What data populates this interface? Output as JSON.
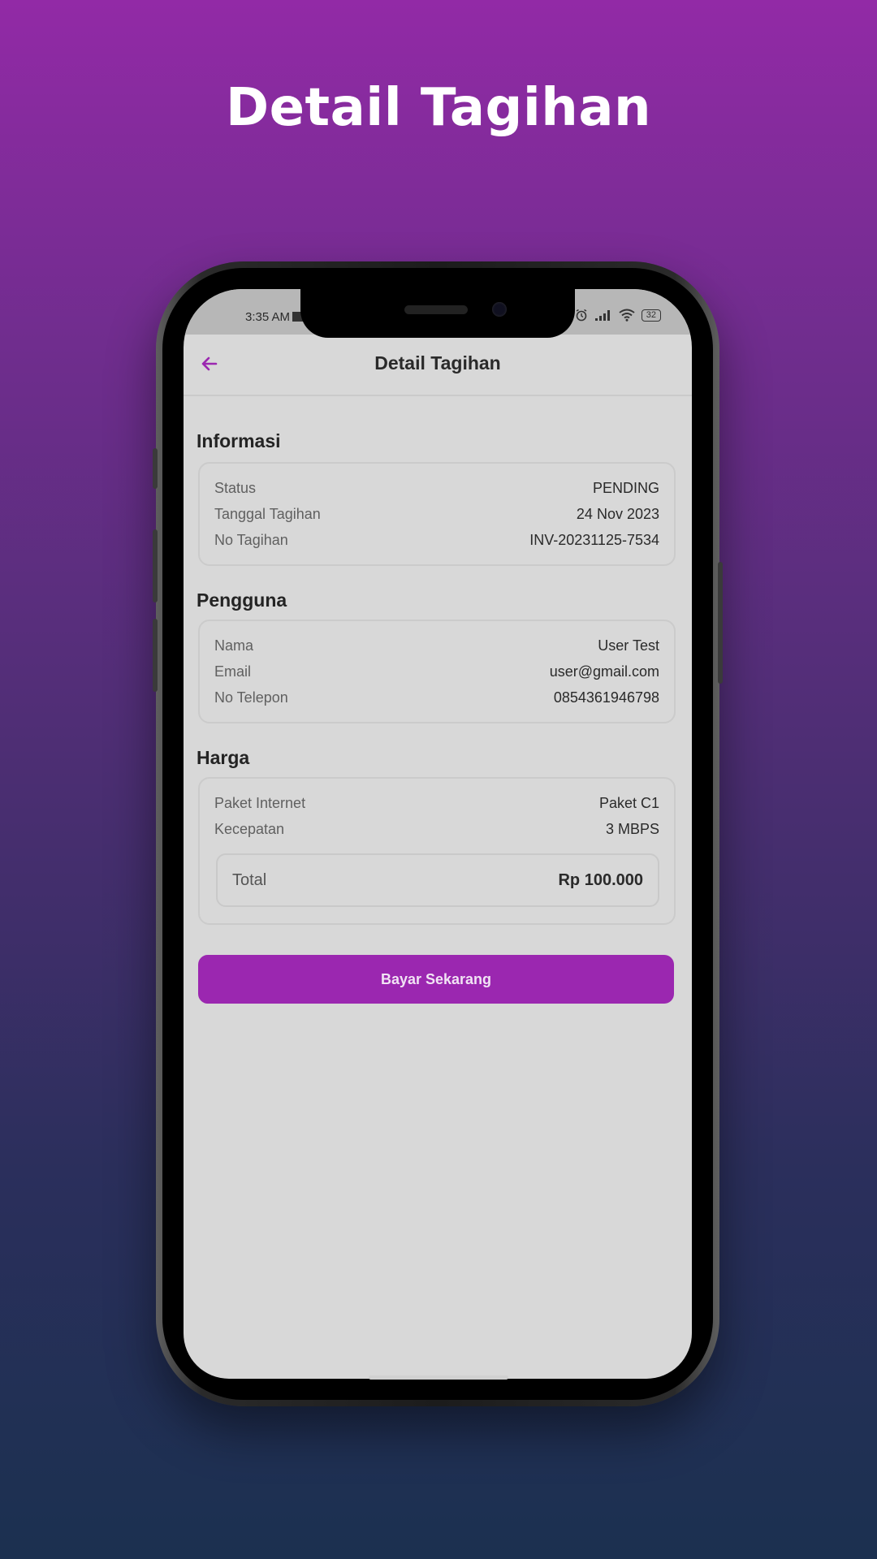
{
  "promo": {
    "title": "Detail Tagihan"
  },
  "status_bar": {
    "time": "3:35 AM",
    "battery": "32"
  },
  "app_bar": {
    "title": "Detail Tagihan"
  },
  "sections": {
    "informasi": {
      "title": "Informasi",
      "rows": [
        {
          "label": "Status",
          "value": "PENDING"
        },
        {
          "label": "Tanggal Tagihan",
          "value": "24 Nov 2023"
        },
        {
          "label": "No Tagihan",
          "value": "INV-20231125-7534"
        }
      ]
    },
    "pengguna": {
      "title": "Pengguna",
      "rows": [
        {
          "label": "Nama",
          "value": "User Test"
        },
        {
          "label": "Email",
          "value": "user@gmail.com"
        },
        {
          "label": "No Telepon",
          "value": "0854361946798"
        }
      ]
    },
    "harga": {
      "title": "Harga",
      "rows": [
        {
          "label": "Paket Internet",
          "value": "Paket C1"
        },
        {
          "label": "Kecepatan",
          "value": "3 MBPS"
        }
      ],
      "total_label": "Total",
      "total_value": "Rp 100.000"
    }
  },
  "pay_button": {
    "label": "Bayar Sekarang"
  },
  "colors": {
    "accent": "#9b27b0",
    "screen_bg": "#d8d8d8",
    "gradient_top": "#922aa6",
    "gradient_bottom": "#1b3050"
  }
}
